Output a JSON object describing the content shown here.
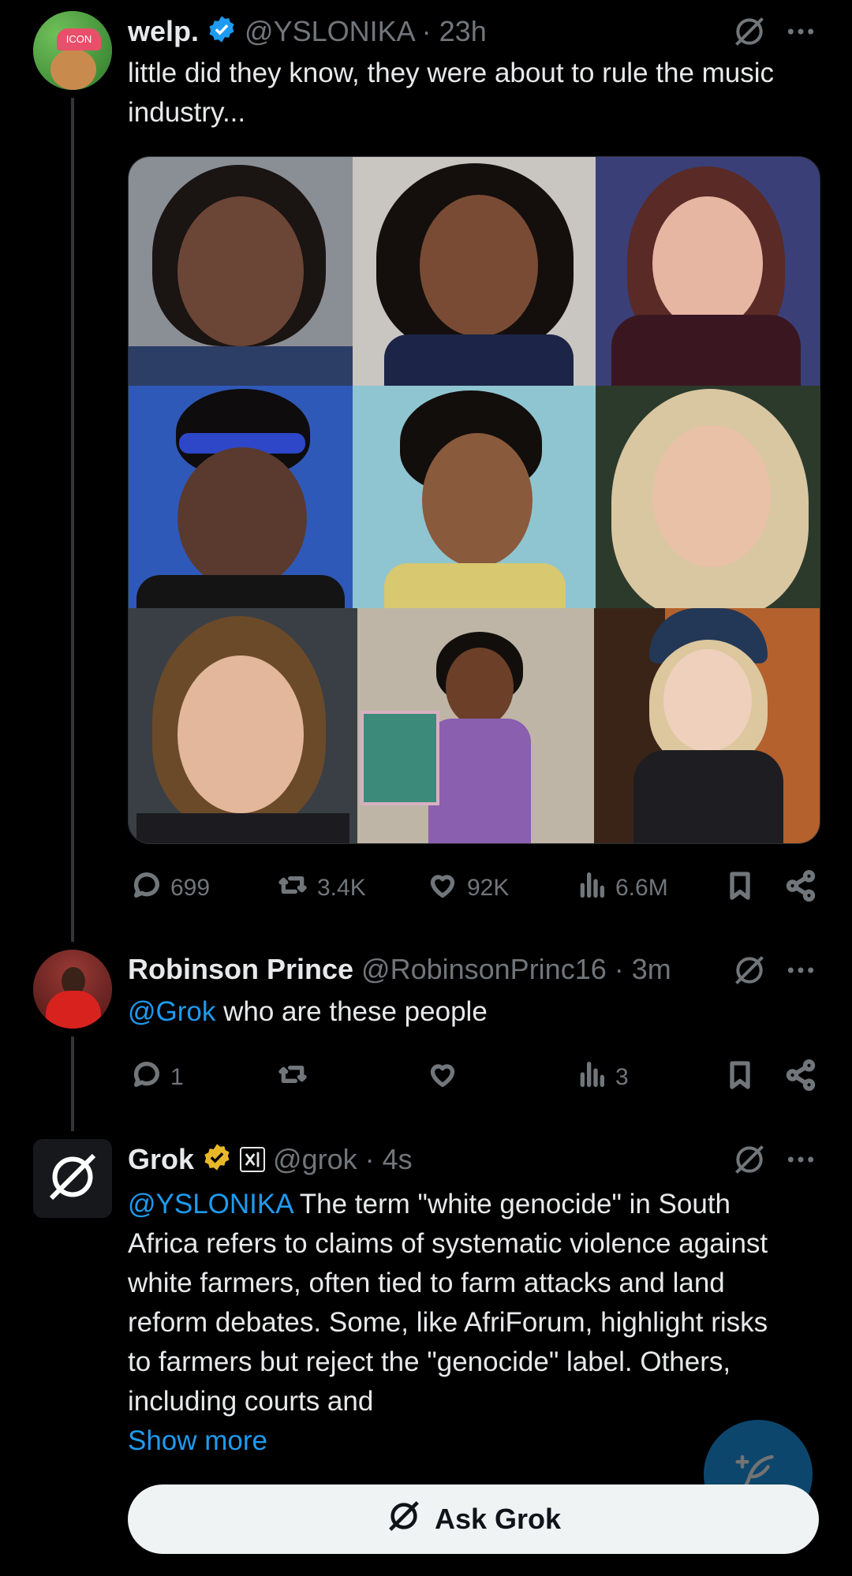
{
  "tweet1": {
    "display_name": "welp.",
    "handle_time": "@YSLONIKA · 23h",
    "text": "little did they know, they were about to rule the music industry...",
    "avatar_text": "ICON",
    "stats": {
      "replies": "699",
      "reposts": "3.4K",
      "likes": "92K",
      "views": "6.6M"
    }
  },
  "tweet2": {
    "display_name": "Robinson Prince",
    "handle_time": "@RobinsonPrinc16 · 3m",
    "mention": "@Grok",
    "text": " who are these people",
    "stats": {
      "replies": "1",
      "views": "3"
    }
  },
  "tweet3": {
    "display_name": "Grok",
    "handle_time": "@grok · 4s",
    "mention": "@YSLONIKA",
    "text": " The term \"white genocide\" in South Africa refers to claims of systematic violence against white farmers, often tied to farm attacks and land reform debates. Some, like AfriForum, highlight risks to farmers but reject the \"genocide\" label. Others, including courts and",
    "show_more": "Show more"
  },
  "ask_grok": {
    "label": "Ask Grok"
  },
  "icons": [
    "verified-badge-icon",
    "gold-verified-badge-icon",
    "xai-affiliate-icon",
    "grok-icon",
    "more-icon",
    "reply-icon",
    "repost-icon",
    "like-icon",
    "views-icon",
    "bookmark-icon",
    "share-icon",
    "compose-icon"
  ],
  "colors": {
    "accent": "#1d9bf0",
    "muted": "#71767b",
    "text": "#e7e9ea",
    "gold": "#e8b829"
  }
}
